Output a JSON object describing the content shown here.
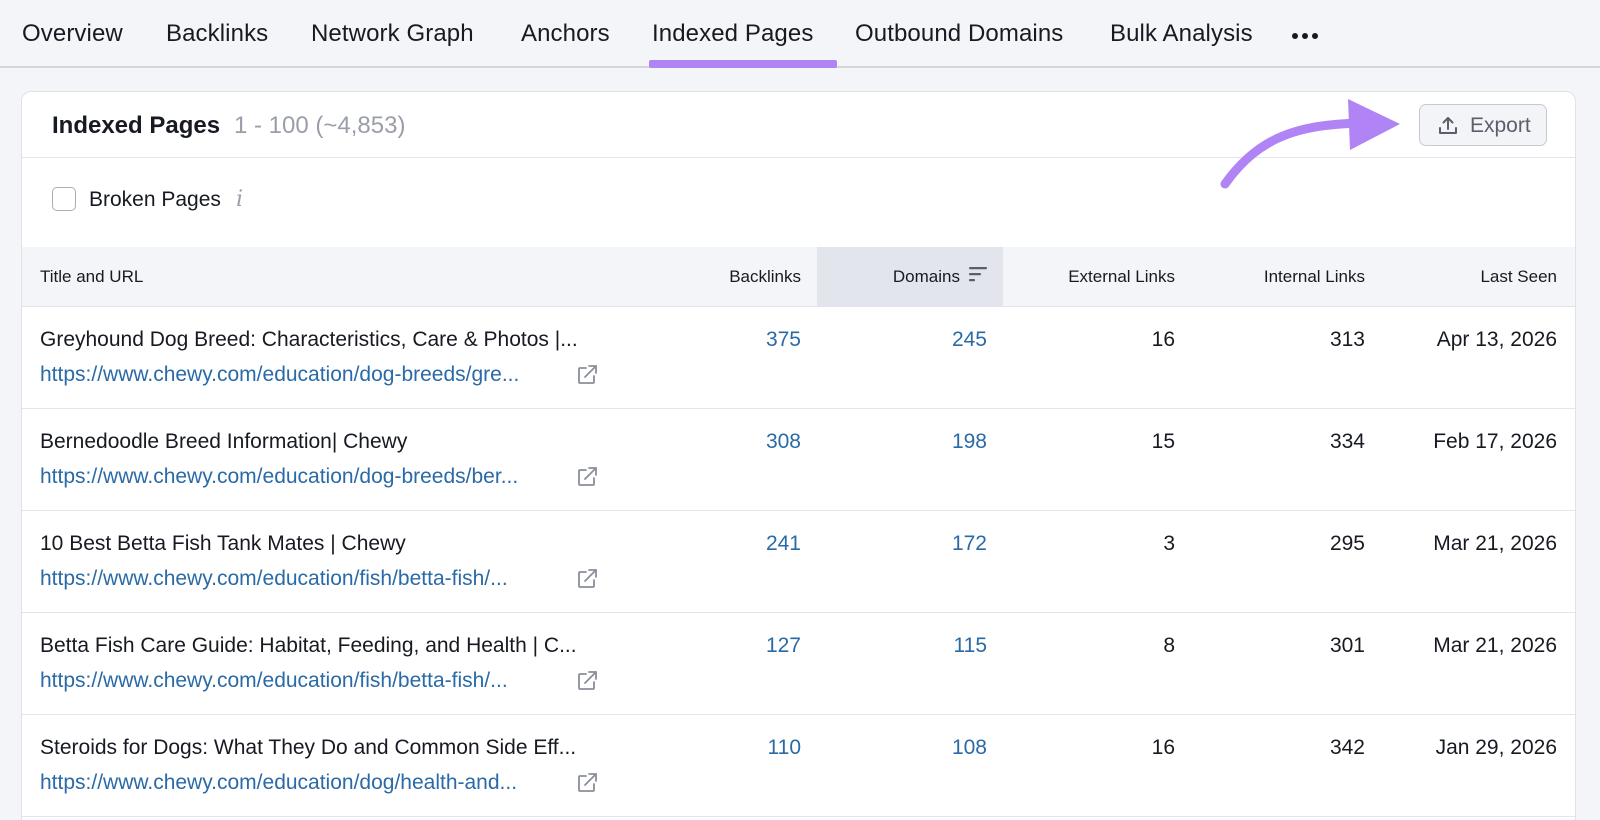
{
  "tabs": [
    {
      "label": "Overview"
    },
    {
      "label": "Backlinks"
    },
    {
      "label": "Network Graph"
    },
    {
      "label": "Anchors"
    },
    {
      "label": "Indexed Pages"
    },
    {
      "label": "Outbound Domains"
    },
    {
      "label": "Bulk Analysis"
    }
  ],
  "active_tab": "Indexed Pages",
  "header": {
    "title": "Indexed Pages",
    "count": "1 - 100 (~4,853)",
    "export_label": "Export"
  },
  "filter": {
    "label": "Broken Pages",
    "checked": false
  },
  "table": {
    "columns": [
      "Title and URL",
      "Backlinks",
      "Domains",
      "External Links",
      "Internal Links",
      "Last Seen"
    ],
    "sorted_column": "Domains",
    "rows": [
      {
        "title": "Greyhound Dog Breed: Characteristics, Care & Photos |...",
        "url": "https://www.chewy.com/education/dog-breeds/gre...",
        "backlinks": "375",
        "domains": "245",
        "external": "16",
        "internal": "313",
        "last_seen": "Apr 13, 2026"
      },
      {
        "title": "Bernedoodle Breed Information| Chewy",
        "url": "https://www.chewy.com/education/dog-breeds/ber...",
        "backlinks": "308",
        "domains": "198",
        "external": "15",
        "internal": "334",
        "last_seen": "Feb 17, 2026"
      },
      {
        "title": "10 Best Betta Fish Tank Mates | Chewy",
        "url": "https://www.chewy.com/education/fish/betta-fish/...",
        "backlinks": "241",
        "domains": "172",
        "external": "3",
        "internal": "295",
        "last_seen": "Mar 21, 2026"
      },
      {
        "title": "Betta Fish Care Guide: Habitat, Feeding, and Health | C...",
        "url": "https://www.chewy.com/education/fish/betta-fish/...",
        "backlinks": "127",
        "domains": "115",
        "external": "8",
        "internal": "301",
        "last_seen": "Mar 21, 2026"
      },
      {
        "title": "Steroids for Dogs: What They Do and Common Side Eff...",
        "url": "https://www.chewy.com/education/dog/health-and...",
        "backlinks": "110",
        "domains": "108",
        "external": "16",
        "internal": "342",
        "last_seen": "Jan 29, 2026"
      }
    ]
  },
  "colors": {
    "accent": "#b084f5",
    "link": "#2a6aa6",
    "muted": "#9a9ea9"
  },
  "icons": [
    "more-horizontal-icon",
    "export-upload-icon",
    "info-icon",
    "sort-icon",
    "external-link-icon"
  ]
}
